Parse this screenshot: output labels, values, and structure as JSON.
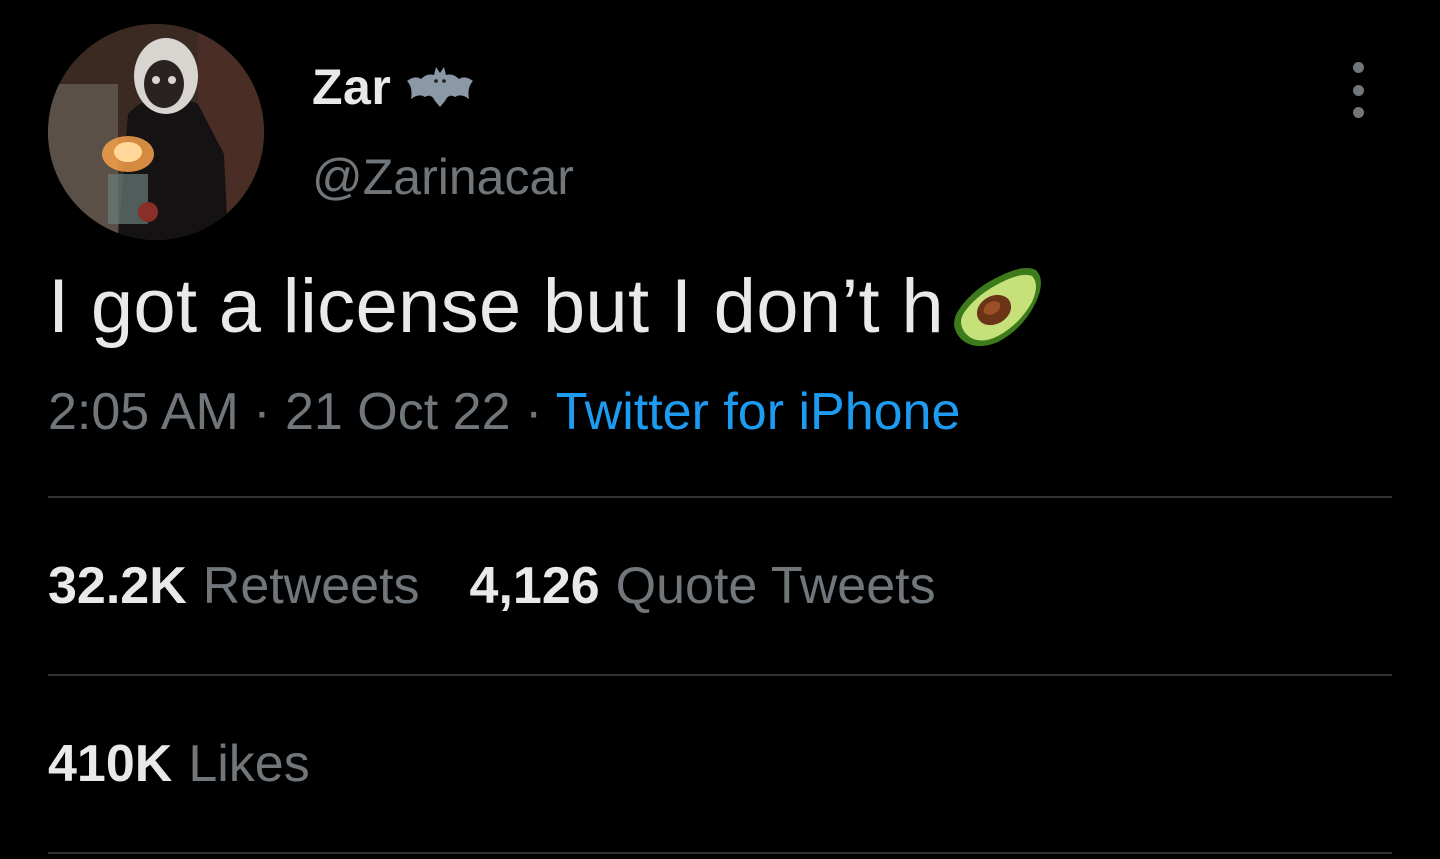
{
  "author": {
    "display_name": "Zar",
    "handle": "@Zarinacar",
    "name_emoji": "bat-icon",
    "avatar": "avatar"
  },
  "tweet": {
    "text": "I got a license but I don’t h",
    "trailing_emoji": "avocado-icon",
    "time": "2:05 AM",
    "separator": "·",
    "date": "21 Oct 22",
    "source": "Twitter for iPhone"
  },
  "stats": {
    "retweets_count": "32.2K",
    "retweets_label": "Retweets",
    "quotes_count": "4,126",
    "quotes_label": "Quote Tweets",
    "likes_count": "410K",
    "likes_label": "Likes"
  },
  "colors": {
    "background": "#000000",
    "primary_text": "#e7e9ea",
    "secondary_text": "#71767b",
    "link": "#1d9bf0",
    "divider": "#2f3336"
  }
}
